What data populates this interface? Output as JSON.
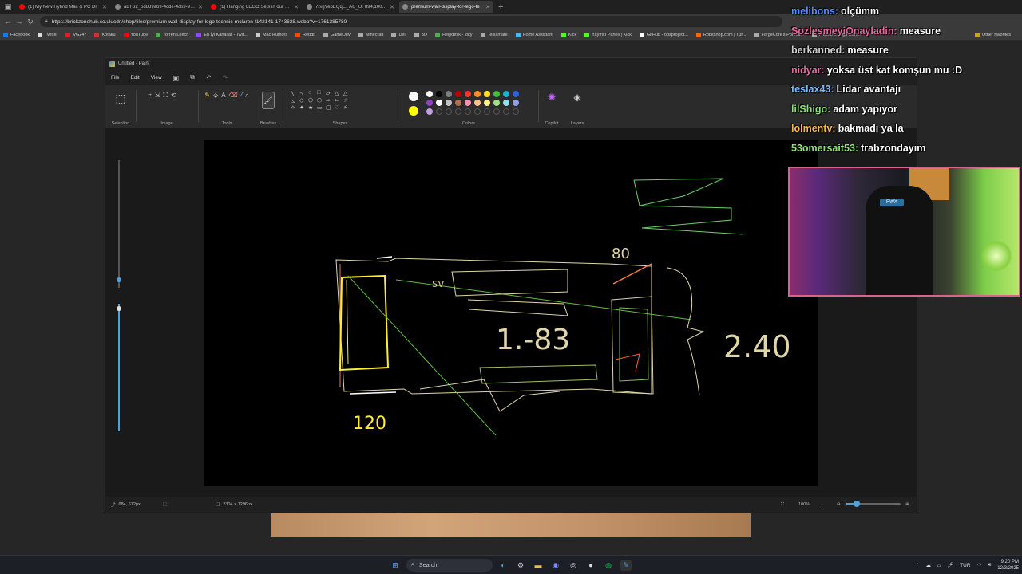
{
  "browser": {
    "tabs": [
      {
        "label": "(1) My New Hybrid Mac & PC Dr",
        "color": "#ff0000"
      },
      {
        "label": "a8TS2_bd889ab9-4cde-4cb9-9031",
        "color": "#888888"
      },
      {
        "label": "(1) Hanging LEGO Sets in our Leg",
        "color": "#ff0000"
      },
      {
        "label": "7rxgYebEQqL._AC_UF894,1000_",
        "color": "#888888"
      },
      {
        "label": "premium-wall-display-for-lego-te",
        "color": "#888888"
      }
    ],
    "url": "https://brickzonehub.co.uk/cdn/shop/files/premium-wall-display-for-lego-technic-mclaren-f142141-1743628.webp?v=1761385780",
    "bookmarks": [
      {
        "label": "Facebook",
        "color": "#1877f2"
      },
      {
        "label": "Twitter",
        "color": "#dddddd"
      },
      {
        "label": "VG247",
        "color": "#e02020"
      },
      {
        "label": "Kotaku",
        "color": "#d32f2f"
      },
      {
        "label": "YouTube",
        "color": "#ff0000"
      },
      {
        "label": "TorrentLeech",
        "color": "#4caf50"
      },
      {
        "label": "En İyi Kanallar - Twit...",
        "color": "#9146ff"
      },
      {
        "label": "Mac Rumors",
        "color": "#cccccc"
      },
      {
        "label": "Reddit",
        "color": "#ff4500"
      },
      {
        "label": "GameDev",
        "color": "#aaaaaa"
      },
      {
        "label": "Minecraft",
        "color": "#aaaaaa"
      },
      {
        "label": "Dell",
        "color": "#aaaaaa"
      },
      {
        "label": "3D",
        "color": "#aaaaaa"
      },
      {
        "label": "Helpdesk - loky",
        "color": "#4caf50"
      },
      {
        "label": "Tesiamate",
        "color": "#aaaaaa"
      },
      {
        "label": "Home Assistant",
        "color": "#41bdf5"
      },
      {
        "label": "Kick",
        "color": "#53fc18"
      },
      {
        "label": "Yayıncı Paneli | Kick",
        "color": "#53fc18"
      },
      {
        "label": "GitHub - obsproject...",
        "color": "#ffffff"
      },
      {
        "label": "Robitshop.com | Tür...",
        "color": "#ff6600"
      },
      {
        "label": "ForgeCore's Portfoli...",
        "color": "#aaaaaa"
      },
      {
        "label": "Fractal Design Nort...",
        "color": "#aaaaaa"
      }
    ],
    "other_bookmarks": "Other favorites"
  },
  "paint": {
    "title": "Untitled - Paint",
    "menu": [
      "File",
      "Edit",
      "View"
    ],
    "groups": {
      "selection": "Selection",
      "image": "Image",
      "tools": "Tools",
      "brushes": "Brushes",
      "shapes": "Shapes",
      "colors": "Colors",
      "copilot": "Copilot",
      "layers": "Layers"
    },
    "palette": [
      "#ffffff",
      "#000000",
      "#7f7f7f",
      "#c00000",
      "#ff3030",
      "#ff9020",
      "#ffe020",
      "#40c040",
      "#20b0d0",
      "#3060e0",
      "#9040c0",
      "#ffffff",
      "#c0c0c0",
      "#b07050",
      "#ff90b0",
      "#ffc090",
      "#fff090",
      "#a0e080",
      "#90e0f0",
      "#90a0e0",
      "#c0a0e0"
    ],
    "primary_color": "#ffff00",
    "status": {
      "cursor": "684, 672px",
      "canvas_size": "2304 × 1296px",
      "zoom": "100%"
    },
    "canvas_text": {
      "label_sv": "sv",
      "label_80": "80",
      "label_middle": "1.-83",
      "label_right": "2.40",
      "label_bottom": "120"
    }
  },
  "chat": [
    {
      "user": "melibons:",
      "message": "olçümm",
      "color": "#5b8cff"
    },
    {
      "user": "SozlesmeyiOnayladin:",
      "message": "measure",
      "color": "#e06c9f"
    },
    {
      "user": "berkanned:",
      "message": "measure",
      "color": "#d0d0d0"
    },
    {
      "user": "nidyar:",
      "message": "yoksa üst kat komşun mu :D",
      "color": "#e06c9f"
    },
    {
      "user": "teslax43:",
      "message": "Lidar avantajı",
      "color": "#7ab8ff"
    },
    {
      "user": "lilShigo:",
      "message": "adam yapıyor",
      "color": "#8ee07a"
    },
    {
      "user": "lolmentv:",
      "message": "bakmadı ya la",
      "color": "#ffb84a"
    },
    {
      "user": "53omersait53:",
      "message": "trabzondayım",
      "color": "#8ee07a"
    }
  ],
  "webcam": {
    "chair_logo": "RWX"
  },
  "taskbar": {
    "search_placeholder": "Search",
    "language": "TUR",
    "time": "9:20 PM",
    "date": "12/3/2025"
  }
}
